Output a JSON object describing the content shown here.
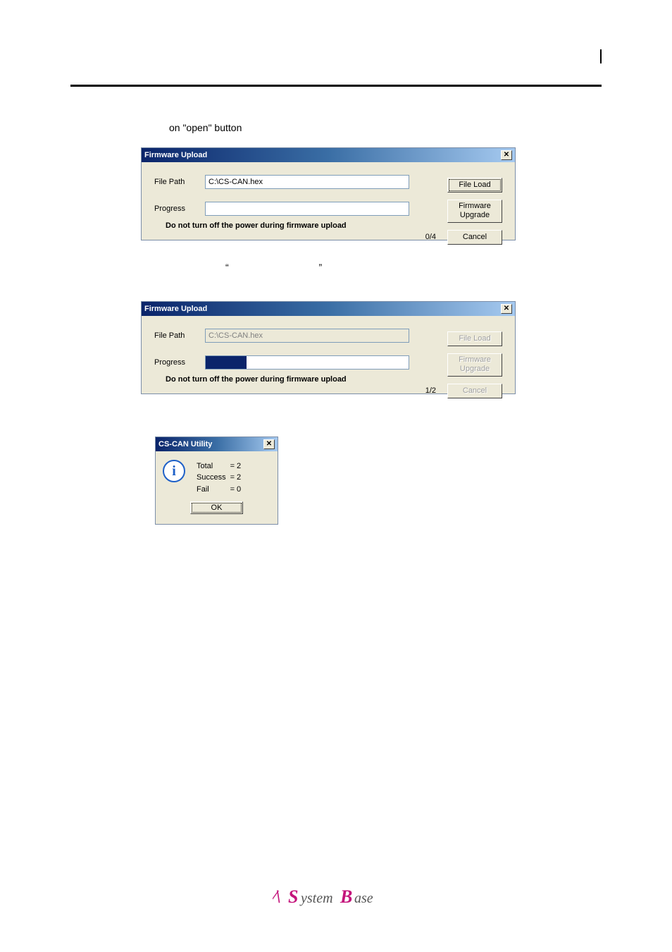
{
  "page": {
    "caption": "on \"open\" button",
    "quote_open": "“",
    "quote_close": "”"
  },
  "dialog1": {
    "title": "Firmware Upload",
    "file_path_label": "File Path",
    "file_path_value": "C:\\CS-CAN.hex",
    "progress_label": "Progress",
    "progress_counter": "0/4",
    "file_load_btn": "File Load",
    "upgrade_btn": "Firmware\nUpgrade",
    "cancel_btn": "Cancel",
    "warning": "Do not turn off the power during firmware upload"
  },
  "dialog2": {
    "title": "Firmware Upload",
    "file_path_label": "File Path",
    "file_path_value": "C:\\CS-CAN.hex",
    "progress_label": "Progress",
    "progress_counter": "1/2",
    "file_load_btn": "File Load",
    "upgrade_btn": "Firmware\nUpgrade",
    "cancel_btn": "Cancel",
    "warning": "Do not turn off the power during firmware upload",
    "progress_percent": 20
  },
  "msgbox": {
    "title": "CS-CAN Utility",
    "stats": {
      "total_label": "Total",
      "total_value": "= 2",
      "success_label": "Success",
      "success_value": "= 2",
      "fail_label": "Fail",
      "fail_value": "= 0"
    },
    "ok": "OK"
  },
  "footer": {
    "brand": "SystemBase"
  }
}
